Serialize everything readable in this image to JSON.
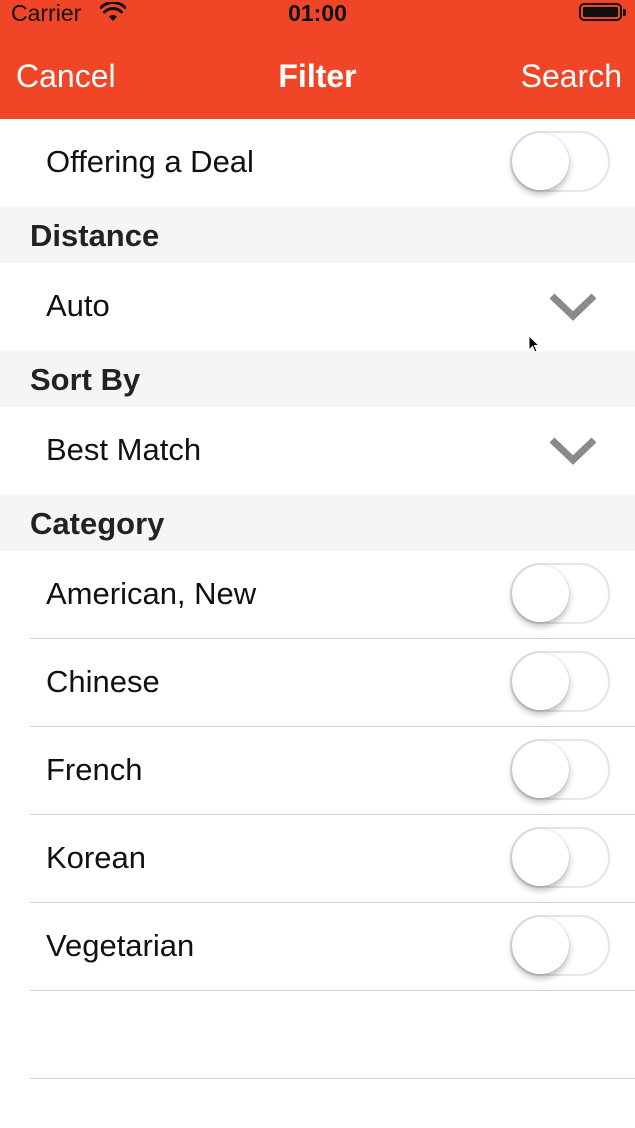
{
  "status_bar": {
    "carrier": "Carrier",
    "time": "01:00"
  },
  "nav": {
    "left": "Cancel",
    "title": "Filter",
    "right": "Search"
  },
  "colors": {
    "nav_background": "#F04527",
    "section_background": "#F5F5F5"
  },
  "deal_row": {
    "label": "Offering a Deal",
    "switch_on": false
  },
  "distance": {
    "header": "Distance",
    "selected": "Auto",
    "icon": "chevron-down-icon"
  },
  "sort": {
    "header": "Sort By",
    "selected": "Best Match",
    "icon": "chevron-down-icon"
  },
  "category": {
    "header": "Category",
    "items": [
      {
        "label": "American, New",
        "switch_on": false
      },
      {
        "label": "Chinese",
        "switch_on": false
      },
      {
        "label": "French",
        "switch_on": false
      },
      {
        "label": "Korean",
        "switch_on": false
      },
      {
        "label": "Vegetarian",
        "switch_on": false
      }
    ]
  }
}
